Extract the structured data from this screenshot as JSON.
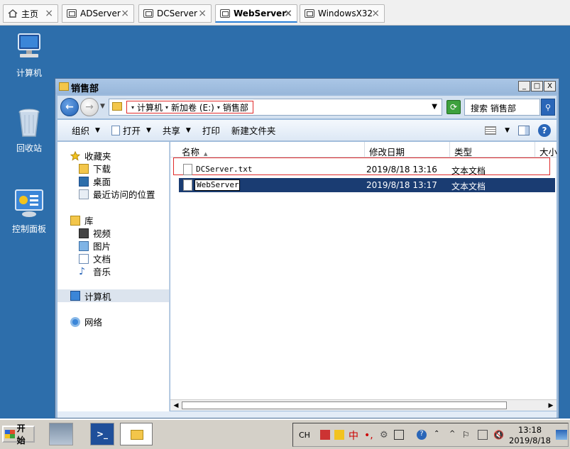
{
  "vm_tabs": [
    {
      "label": "主页",
      "icon": "home-icon",
      "active": false
    },
    {
      "label": "ADServer",
      "icon": "vm-icon",
      "active": false
    },
    {
      "label": "DCServer",
      "icon": "vm-icon",
      "active": false
    },
    {
      "label": "WebServer",
      "icon": "vm-icon",
      "active": true
    },
    {
      "label": "WindowsX32",
      "icon": "vm-icon",
      "active": false
    }
  ],
  "tab_close_glyph": "×",
  "desktop_icons": [
    {
      "label": "计算机",
      "icon": "computer-icon"
    },
    {
      "label": "回收站",
      "icon": "recycle-bin-icon"
    },
    {
      "label": "控制面板",
      "icon": "control-panel-icon"
    }
  ],
  "window": {
    "title": "销售部",
    "buttons": {
      "minimize": "_",
      "maximize": "□",
      "close": "X"
    },
    "breadcrumbs": [
      "计算机",
      "新加卷 (E:)",
      "销售部"
    ],
    "search_placeholder": "搜索 销售部",
    "toolbar": {
      "organize": "组织",
      "open": "打开",
      "share": "共享",
      "print": "打印",
      "new_folder": "新建文件夹"
    },
    "nav": {
      "favorites": "收藏夹",
      "downloads": "下载",
      "desktop": "桌面",
      "recent": "最近访问的位置",
      "libraries": "库",
      "videos": "视频",
      "pictures": "图片",
      "documents": "文档",
      "music": "音乐",
      "computer": "计算机",
      "network": "网络"
    },
    "columns": [
      "名称",
      "修改日期",
      "类型",
      "大小"
    ],
    "files": [
      {
        "name": "DCServer.txt",
        "date": "2019/8/18 13:16",
        "type": "文本文档",
        "selected": false
      },
      {
        "name": "WebServer",
        "date": "2019/8/18 13:17",
        "type": "文本文档",
        "selected": true,
        "renaming": true
      }
    ]
  },
  "taskbar": {
    "start_label": "开始",
    "lang": "CH",
    "ime_text": "中",
    "time": "13:18",
    "date": "2019/8/18"
  }
}
